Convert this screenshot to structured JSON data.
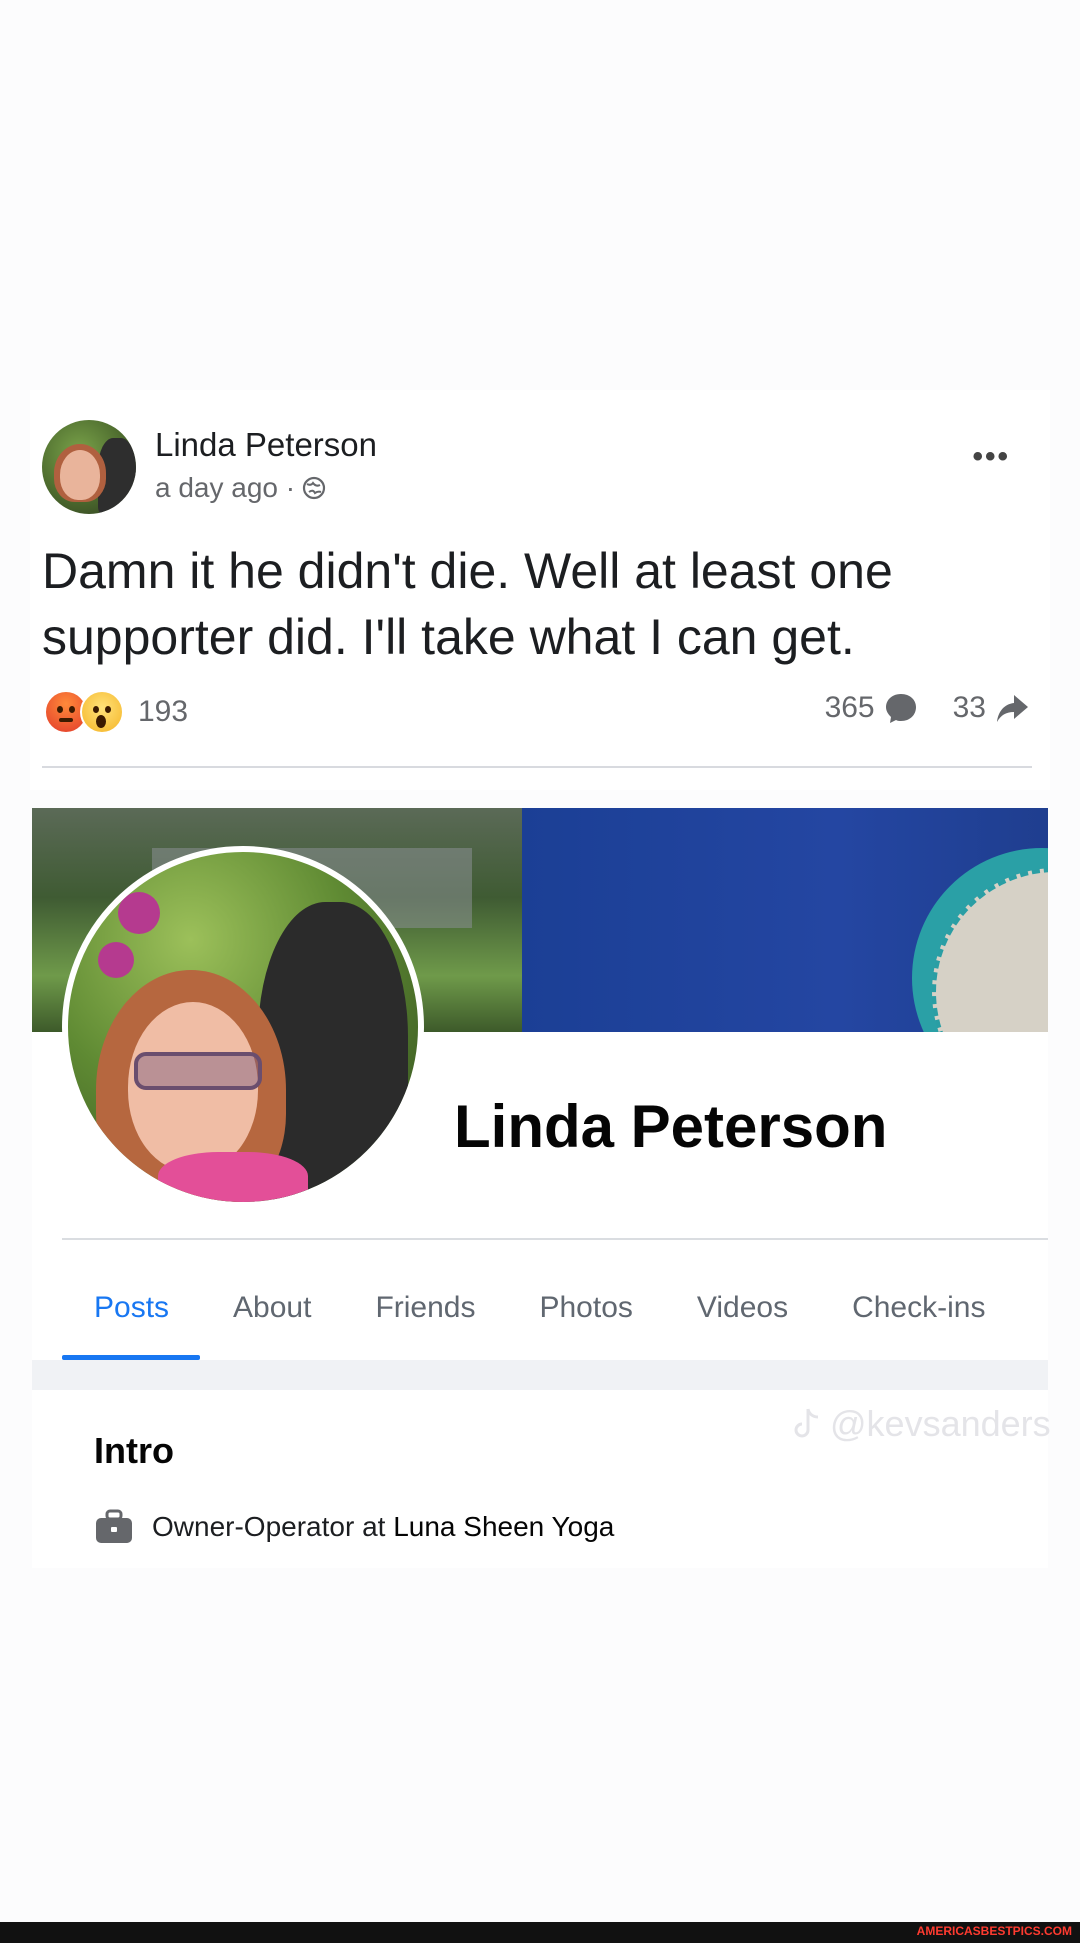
{
  "post": {
    "author": "Linda Peterson",
    "time": "a day ago · ",
    "more_label": "•••",
    "text": "Damn it he didn't die. Well at least one supporter did. I'll take what I can get.",
    "reaction_count": "193",
    "comment_count": "365",
    "share_count": "33",
    "reaction_icons": [
      "angry-emoji-icon",
      "wow-emoji-icon"
    ]
  },
  "profile": {
    "name": "Linda Peterson",
    "tabs": [
      {
        "label": "Posts",
        "active": true
      },
      {
        "label": "About"
      },
      {
        "label": "Friends"
      },
      {
        "label": "Photos"
      },
      {
        "label": "Videos"
      },
      {
        "label": "Check-ins"
      }
    ],
    "intro": {
      "title": "Intro",
      "work_prefix": "Owner-Operator at ",
      "work_org": "Luna Sheen Yoga"
    }
  },
  "watermark": "@kevsanders",
  "footer": "AMERICASBESTPICS.COM",
  "colors": {
    "accent": "#1877f2",
    "text": "#1c1e21",
    "muted": "#65676b"
  }
}
